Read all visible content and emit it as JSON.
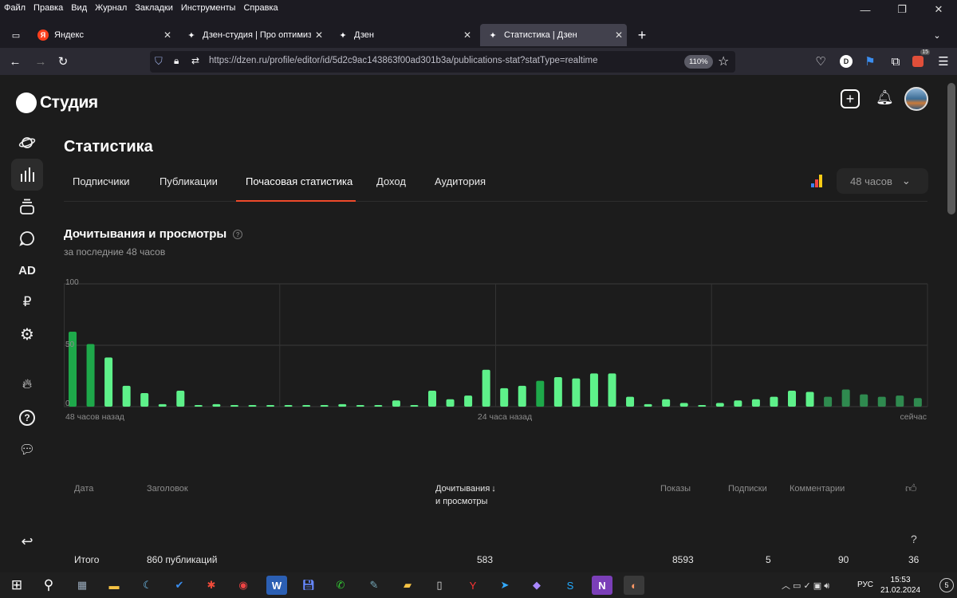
{
  "menubar": [
    "Файл",
    "Правка",
    "Вид",
    "Журнал",
    "Закладки",
    "Инструменты",
    "Справка"
  ],
  "tabs": [
    {
      "title": "Яндекс",
      "icon": "yandex-icon"
    },
    {
      "title": "Дзен-студия | Про оптимизац",
      "icon": "dzen-icon"
    },
    {
      "title": "Дзен",
      "icon": "dzen-icon"
    },
    {
      "title": "Статистика | Дзен",
      "icon": "dzen-icon",
      "active": true
    }
  ],
  "url": "https://dzen.ru/profile/editor/id/5d2c9ac143863f00ad301b3a/publications-stat?statType=realtime",
  "zoom": "110%",
  "account_initial": "D",
  "badge_count": "15",
  "brand": "Студия",
  "page_title": "Статистика",
  "stat_tabs": [
    "Подписчики",
    "Публикации",
    "Почасовая статистика",
    "Доход",
    "Аудитория"
  ],
  "active_stat_tab": "Почасовая статистика",
  "period": "48 часов",
  "section": {
    "title": "Дочитывания и просмотры",
    "subtitle": "за последние 48 часов"
  },
  "sidebar_ad": "AD",
  "sidebar_ruble": "₽",
  "chart_data": {
    "type": "bar",
    "y_ticks": [
      "100",
      "50",
      "0"
    ],
    "ylim": [
      0,
      100
    ],
    "x_labels": {
      "start": "48 часов назад",
      "middle": "24 часа назад",
      "end": "сейчас"
    },
    "colors": {
      "light": "#5ef18a",
      "dark": "#1ea84a",
      "muted": "#2f8a4f"
    },
    "values": [
      61,
      51,
      40,
      17,
      11,
      2,
      13,
      1,
      2,
      1,
      1,
      1,
      1,
      1,
      1,
      2,
      1,
      1,
      5,
      1,
      13,
      6,
      9,
      30,
      15,
      17,
      21,
      24,
      23,
      27,
      27,
      8,
      2,
      6,
      3,
      1,
      3,
      5,
      6,
      8,
      13,
      12,
      8,
      14,
      10,
      8,
      9,
      7
    ],
    "color_keys": [
      "dark",
      "dark",
      "light",
      "light",
      "light",
      "light",
      "light",
      "light",
      "light",
      "light",
      "light",
      "light",
      "light",
      "light",
      "light",
      "light",
      "light",
      "light",
      "light",
      "light",
      "light",
      "light",
      "light",
      "light",
      "light",
      "light",
      "dark",
      "light",
      "light",
      "light",
      "light",
      "light",
      "light",
      "light",
      "light",
      "light",
      "light",
      "light",
      "light",
      "light",
      "light",
      "light",
      "muted",
      "muted",
      "muted",
      "muted",
      "muted",
      "muted"
    ]
  },
  "table": {
    "headers": [
      "Дата",
      "Заголовок",
      "Дочитывания",
      "и просмотры",
      "Показы",
      "Подписки",
      "Комментарии"
    ],
    "total": {
      "label": "Итого",
      "title": "860 публикаций",
      "reads": "583",
      "shows": "8593",
      "subs": "5",
      "comments": "90",
      "likes": "36"
    }
  },
  "help": "?",
  "taskbar": {
    "lang": "РУС",
    "time": "15:53",
    "date": "21.02.2024",
    "notif": "5"
  }
}
